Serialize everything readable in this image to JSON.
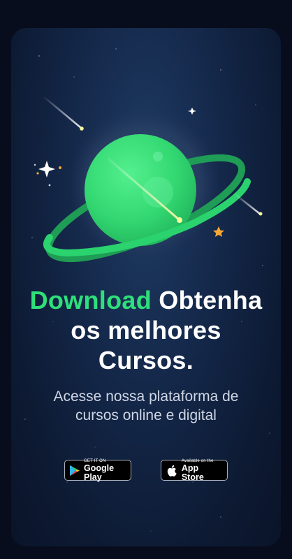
{
  "headline": {
    "accent": "Download",
    "rest_line1": "Obtenha",
    "line2": "os melhores",
    "line3": "Cursos."
  },
  "subtitle": {
    "line1": "Acesse nossa plataforma de",
    "line2": "cursos online e digital"
  },
  "badges": {
    "google": {
      "small": "GET IT ON",
      "big": "Google Play",
      "icon": "google-play-icon"
    },
    "apple": {
      "small": "Available on the",
      "big": "App Store",
      "icon": "apple-icon"
    }
  },
  "colors": {
    "accent": "#2ee07a",
    "planet": "#35dc78",
    "background": "#14284a"
  }
}
